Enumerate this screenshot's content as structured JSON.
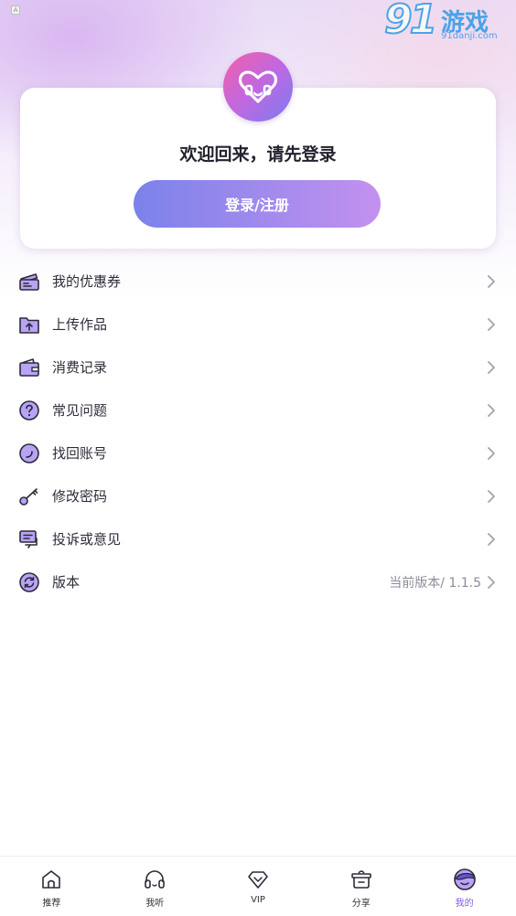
{
  "status": {
    "indicator": "A"
  },
  "watermark": {
    "number": "91",
    "game": "游戏",
    "url": "91danji.com"
  },
  "login_card": {
    "welcome_text": "欢迎回来，请先登录",
    "login_button_label": "登录/注册"
  },
  "menu": {
    "items": [
      {
        "label": "我的优惠券",
        "icon": "coupon-icon"
      },
      {
        "label": "上传作品",
        "icon": "upload-folder-icon"
      },
      {
        "label": "消费记录",
        "icon": "wallet-icon"
      },
      {
        "label": "常见问题",
        "icon": "question-icon"
      },
      {
        "label": "找回账号",
        "icon": "account-recover-icon"
      },
      {
        "label": "修改密码",
        "icon": "key-icon"
      },
      {
        "label": "投诉或意见",
        "icon": "feedback-icon"
      },
      {
        "label": "版本",
        "icon": "refresh-icon",
        "extra": "当前版本/ 1.1.5"
      }
    ]
  },
  "tabbar": {
    "tabs": [
      {
        "label": "推荐",
        "icon": "home-icon"
      },
      {
        "label": "我听",
        "icon": "headphones-icon"
      },
      {
        "label": "VIP",
        "icon": "diamond-icon"
      },
      {
        "label": "分享",
        "icon": "share-pot-icon"
      },
      {
        "label": "我的",
        "icon": "profile-icon",
        "active": true
      }
    ]
  },
  "colors": {
    "accent": "#7e5ee0",
    "icon_fill": "#b9a3f5",
    "icon_stroke": "#2b2b3a",
    "button_gradient_start": "#7b82ea",
    "button_gradient_end": "#c391ef"
  }
}
